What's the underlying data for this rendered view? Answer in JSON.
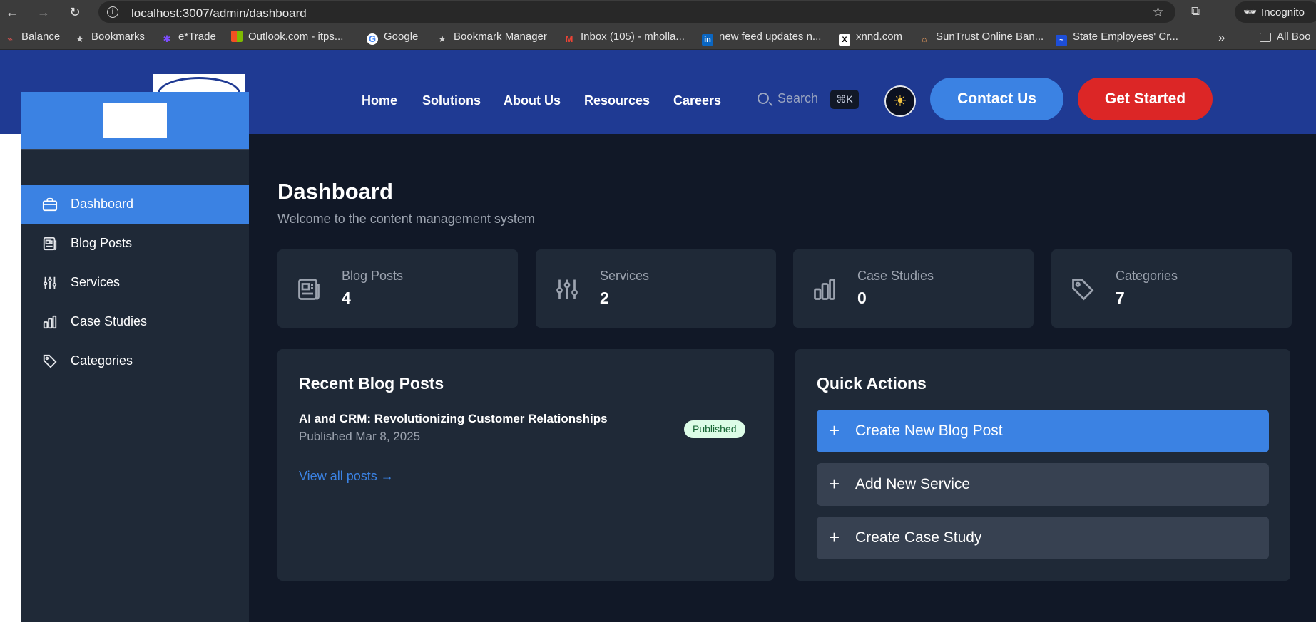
{
  "browser": {
    "url": "localhost:3007/admin/dashboard",
    "profile_label": "Incognito",
    "bookmarks": [
      {
        "label": "Balance",
        "icon": "balance-icon"
      },
      {
        "label": "Bookmarks",
        "icon": "star-icon"
      },
      {
        "label": "e*Trade",
        "icon": "etrade-icon"
      },
      {
        "label": "Outlook.com - itps...",
        "icon": "microsoft-icon"
      },
      {
        "label": "Google",
        "icon": "google-icon"
      },
      {
        "label": "Bookmark Manager",
        "icon": "star-icon"
      },
      {
        "label": "Inbox (105) - mholla...",
        "icon": "gmail-icon"
      },
      {
        "label": "new feed updates n...",
        "icon": "linkedin-icon"
      },
      {
        "label": "xnnd.com",
        "icon": "x-icon"
      },
      {
        "label": "SunTrust Online Ban...",
        "icon": "suntrust-icon"
      },
      {
        "label": "State Employees' Cr...",
        "icon": "secu-icon"
      },
      {
        "label": "All Boo",
        "icon": "folder-icon"
      }
    ]
  },
  "site_header": {
    "nav": [
      "Home",
      "Solutions",
      "About Us",
      "Resources",
      "Careers"
    ],
    "search_label": "Search",
    "search_shortcut": "⌘K",
    "contact_label": "Contact Us",
    "cta_label": "Get Started"
  },
  "sidebar": {
    "items": [
      {
        "label": "Dashboard",
        "icon": "briefcase-icon",
        "active": true
      },
      {
        "label": "Blog Posts",
        "icon": "newspaper-icon",
        "active": false
      },
      {
        "label": "Services",
        "icon": "sliders-icon",
        "active": false
      },
      {
        "label": "Case Studies",
        "icon": "bar-chart-icon",
        "active": false
      },
      {
        "label": "Categories",
        "icon": "tag-icon",
        "active": false
      }
    ]
  },
  "main": {
    "title": "Dashboard",
    "subtitle": "Welcome to the content management system",
    "stats": [
      {
        "label": "Blog Posts",
        "value": "4",
        "icon": "newspaper-icon"
      },
      {
        "label": "Services",
        "value": "2",
        "icon": "sliders-icon"
      },
      {
        "label": "Case Studies",
        "value": "0",
        "icon": "bar-chart-icon"
      },
      {
        "label": "Categories",
        "value": "7",
        "icon": "tag-icon"
      }
    ],
    "recent": {
      "title": "Recent Blog Posts",
      "posts": [
        {
          "title": "AI and CRM: Revolutionizing Customer Relationships",
          "date": "Published Mar 8, 2025",
          "status": "Published"
        }
      ],
      "view_all": "View all posts →"
    },
    "quick_actions": {
      "title": "Quick Actions",
      "actions": [
        {
          "label": "Create New Blog Post",
          "style": "primary"
        },
        {
          "label": "Add New Service",
          "style": "secondary"
        },
        {
          "label": "Create Case Study",
          "style": "secondary"
        }
      ]
    }
  },
  "colors": {
    "header_bg": "#1f3a93",
    "accent": "#3b82e3",
    "cta": "#dc2626",
    "page_bg": "#111827",
    "card_bg": "#1f2937"
  }
}
